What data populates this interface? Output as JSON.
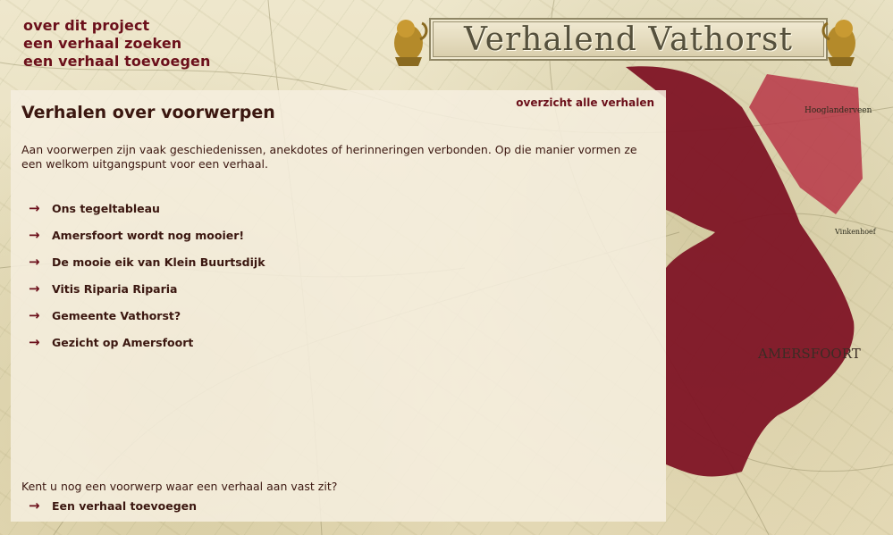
{
  "nav": {
    "items": [
      "over dit project",
      "een verhaal zoeken",
      "een verhaal toevoegen"
    ]
  },
  "banner": {
    "title": "Verhalend Vathorst"
  },
  "map": {
    "labels": [
      "Hooglanderveen",
      "Vinkenhoef",
      "AMERSFOORT"
    ],
    "region_color": "#7e1425",
    "region_color_light": "#b73646"
  },
  "panel": {
    "title": "Verhalen over voorwerpen",
    "overview_link": "overzicht alle verhalen",
    "intro": "Aan voorwerpen zijn vaak geschiedenissen, anekdotes of herinneringen verbonden. Op die manier vormen ze een welkom uitgangspunt voor een verhaal.",
    "stories": [
      "Ons tegeltableau",
      "Amersfoort wordt nog mooier!",
      "De mooie eik van Klein Buurtsdijk",
      "Vitis Riparia Riparia",
      "Gemeente Vathorst?",
      "Gezicht op Amersfoort"
    ],
    "question": "Kent u nog een voorwerp waar een verhaal aan vast zit?",
    "add_link": "Een verhaal toevoegen"
  },
  "colors": {
    "accent": "#6b0f1a",
    "text": "#3b1710"
  },
  "icons": {
    "arrow": "→",
    "lion": "lion-icon"
  }
}
